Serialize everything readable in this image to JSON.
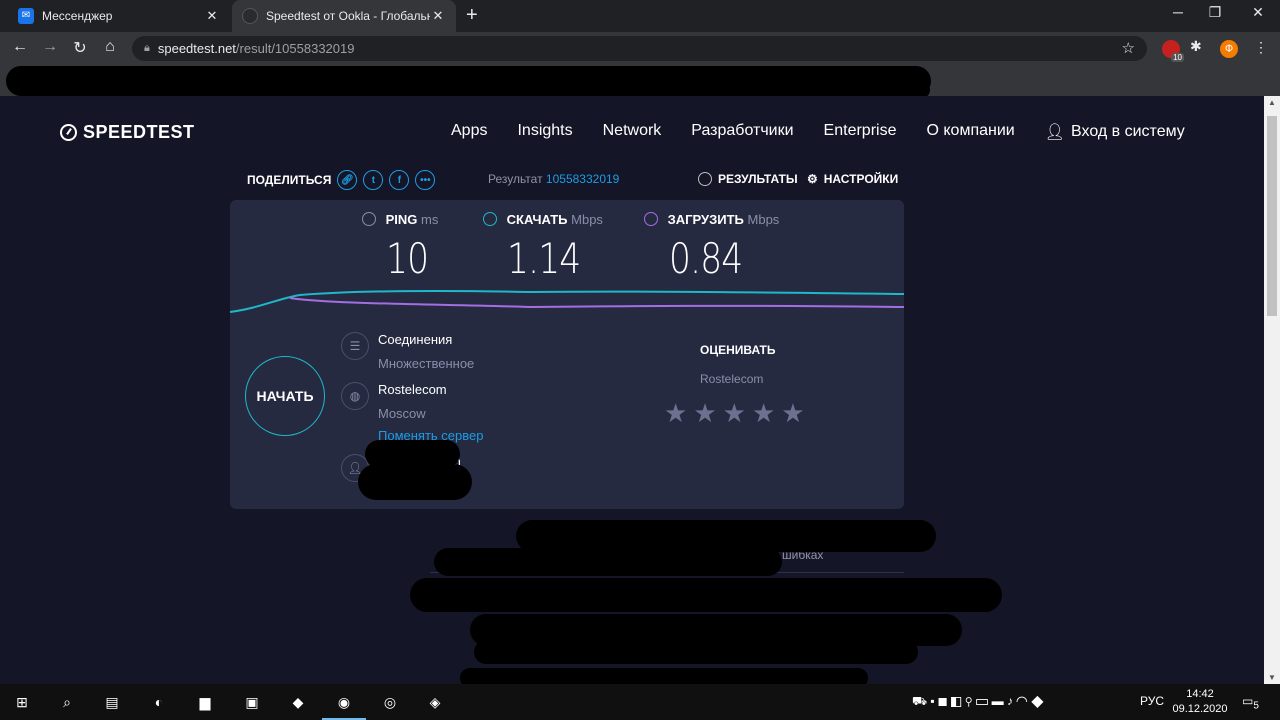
{
  "browser": {
    "tabs": [
      {
        "title": "Мессенджер",
        "favicon": "messenger-icon"
      },
      {
        "title": "Speedtest от Ookla - Глобальный",
        "favicon": "speedtest-icon"
      }
    ],
    "url_host": "speedtest.net",
    "url_path": "/result/10558332019",
    "extensions": {
      "badge_count": "10",
      "profile_letter": "Ф"
    }
  },
  "site": {
    "logo_text": "SPEEDTEST",
    "nav": [
      "Apps",
      "Insights",
      "Network",
      "Разработчики",
      "Enterprise",
      "О компании"
    ],
    "login": "Вход в систему"
  },
  "result_bar": {
    "share_label": "ПОДЕЛИТЬСЯ",
    "result_label": "Результат",
    "result_id": "10558332019",
    "results_tab": "РЕЗУЛЬТАТЫ",
    "settings_tab": "НАСТРОЙКИ"
  },
  "metrics": {
    "ping": {
      "label": "PING",
      "unit": "ms",
      "value": "10"
    },
    "download": {
      "label": "СКАЧАТЬ",
      "unit": "Mbps",
      "value": "1.14"
    },
    "upload": {
      "label": "ЗАГРУЗИТЬ",
      "unit": "Mbps",
      "value": "0.84"
    }
  },
  "start_button": "НАЧАТЬ",
  "connection": {
    "title": "Соединения",
    "value": "Множественное"
  },
  "server": {
    "isp": "Rostelecom",
    "city": "Moscow",
    "change_link": "Поменять сервер"
  },
  "user_partial": "m",
  "rating": {
    "title": "ОЦЕНИВАТЬ",
    "provider": "Rostelecom",
    "stars": 5
  },
  "lower_partial": "шибках",
  "colors": {
    "download": "#1eb8c8",
    "upload": "#a36ee3",
    "accent": "#1c9de3",
    "page_bg": "#141526",
    "panel_bg": "#262a41"
  },
  "taskbar": {
    "lang": "РУС",
    "time": "14:42",
    "date": "09.12.2020",
    "notifications": "5"
  }
}
